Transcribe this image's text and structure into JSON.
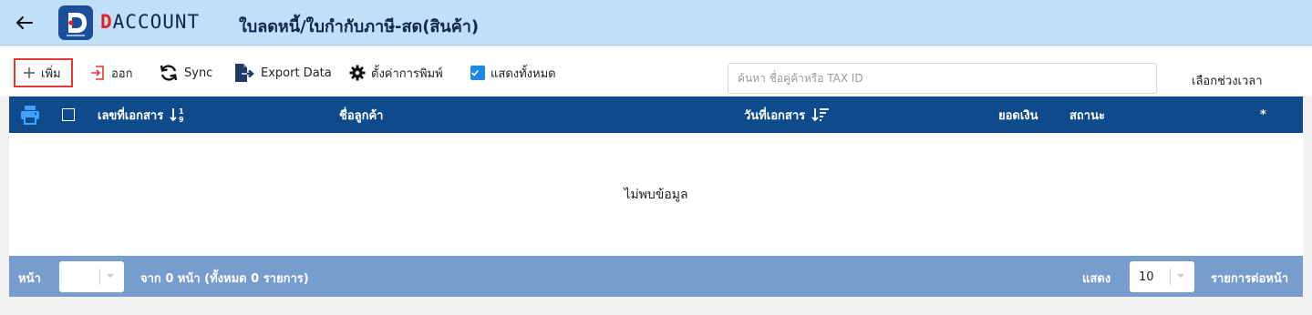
{
  "header": {
    "logo_text_rest": "ACCOUNT",
    "title": "ใบลดหนี้/ใบกำกับภาษี-สด(สินค้า)"
  },
  "toolbar": {
    "add_label": "เพิ่ม",
    "exit_label": "ออก",
    "sync_label": "Sync",
    "export_label": "Export Data",
    "print_settings_label": "ตั้งค่าการพิมพ์",
    "show_all_label": "แสดงทั้งหมด",
    "show_all_checked": true,
    "search_placeholder": "ค้นหา ชื่อคู่ค้าหรือ TAX ID",
    "search_value": "",
    "period_label": "เลือกช่วงเวลา"
  },
  "table": {
    "columns": {
      "doc_no": "เลขที่เอกสาร",
      "customer": "ชื่อลูกค้า",
      "doc_date": "วันที่เอกสาร",
      "amount": "ยอดเงิน",
      "status": "สถานะ",
      "extra": "*"
    },
    "rows": [],
    "empty_message": "ไม่พบข้อมูล"
  },
  "pager": {
    "page_label": "หน้า",
    "page_value": "",
    "summary": "จาก 0 หน้า (ทั้งหมด 0 รายการ)",
    "show_label": "แสดง",
    "page_size": "10",
    "per_page_label": "รายการต่อหน้า"
  },
  "colors": {
    "header_bg": "#bfe0f8",
    "table_header_bg": "#0f4a8a",
    "pager_bg": "#769dce",
    "accent_blue": "#1e88e5",
    "logo_red": "#e02424",
    "add_button_outline": "#e53935"
  },
  "icons": {
    "back": "arrow-left-icon",
    "add": "plus-icon",
    "exit": "exit-icon",
    "sync": "sync-icon",
    "export": "export-file-icon",
    "print_settings": "gear-icon",
    "print": "printer-icon",
    "sort": "sort-icon"
  }
}
